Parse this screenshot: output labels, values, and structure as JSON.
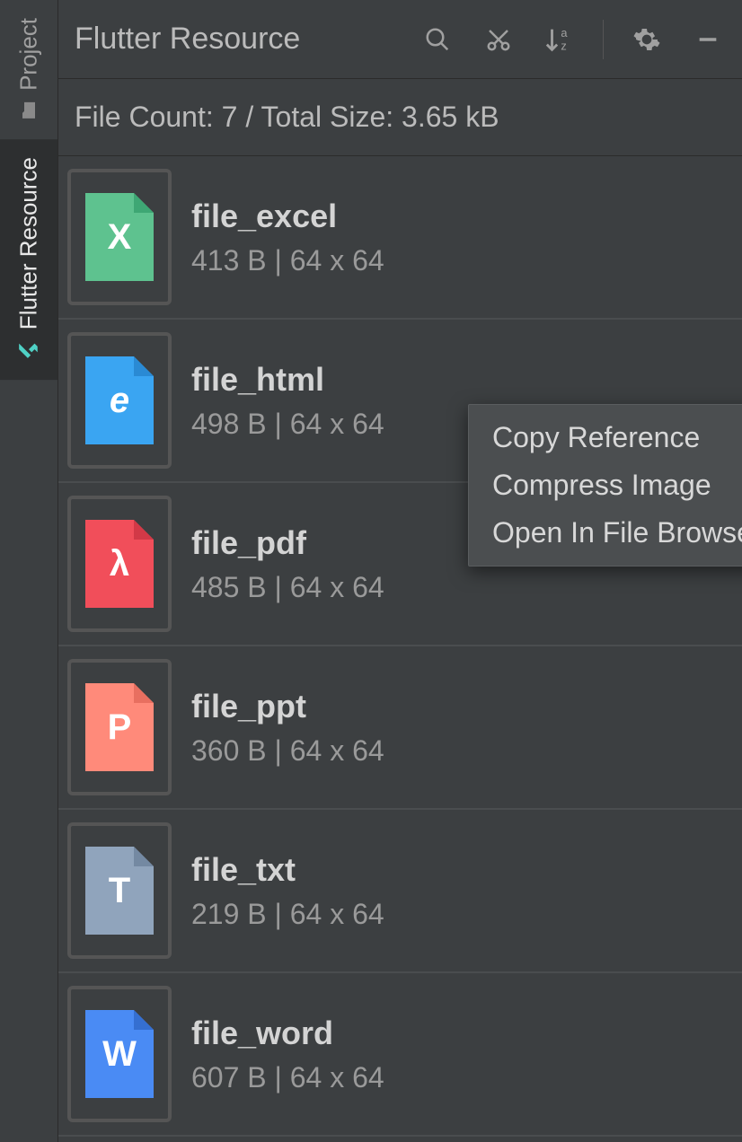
{
  "sidebar": {
    "tabs": [
      {
        "label": "Project",
        "active": false
      },
      {
        "label": "Flutter Resource",
        "active": true
      }
    ]
  },
  "header": {
    "title": "Flutter Resource",
    "icons": [
      "search",
      "cut",
      "sort-az",
      "gear",
      "minimize"
    ]
  },
  "status": {
    "text": "File Count: 7 / Total Size: 3.65 kB"
  },
  "files": [
    {
      "name": "file_excel",
      "meta": "413 B | 64 x 64",
      "letter": "X",
      "color": "#5ec28f",
      "fold": "#3ea774"
    },
    {
      "name": "file_html",
      "meta": "498 B | 64 x 64",
      "letter": "e",
      "color": "#3aa5f2",
      "fold": "#2a8ad4",
      "italic": true
    },
    {
      "name": "file_pdf",
      "meta": "485 B | 64 x 64",
      "letter": "λ",
      "color": "#f14e5a",
      "fold": "#d23947"
    },
    {
      "name": "file_ppt",
      "meta": "360 B | 64 x 64",
      "letter": "P",
      "color": "#ff8a7a",
      "fold": "#e86f60"
    },
    {
      "name": "file_txt",
      "meta": "219 B | 64 x 64",
      "letter": "T",
      "color": "#90a4bc",
      "fold": "#7489a2"
    },
    {
      "name": "file_word",
      "meta": "607 B | 64 x 64",
      "letter": "W",
      "color": "#4a8bf4",
      "fold": "#356fd1"
    }
  ],
  "context_menu": {
    "items": [
      "Copy Reference",
      "Compress Image",
      "Open In File Browser"
    ]
  }
}
